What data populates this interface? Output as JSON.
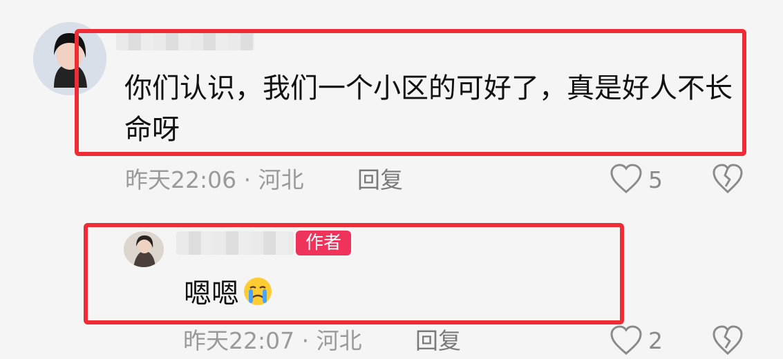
{
  "main_comment": {
    "text": "你们认识，我们一个小区的可好了，真是好人不长命呀",
    "time_location": "昨天22:06 · 河北",
    "reply_label": "回复",
    "likes": "5",
    "icons": {
      "like": "heart-outline-icon",
      "dislike": "broken-heart-icon"
    }
  },
  "reply_comment": {
    "author_badge": "作者",
    "text": "嗯嗯",
    "emoji": "crying-face-emoji",
    "time_location": "昨天22:07 · 河北",
    "reply_label": "回复",
    "likes": "2",
    "icons": {
      "like": "heart-outline-icon",
      "dislike": "broken-heart-icon"
    }
  },
  "colors": {
    "highlight": "#ef2b35",
    "badge": "#f0335a",
    "meta": "#9a9a9a"
  }
}
